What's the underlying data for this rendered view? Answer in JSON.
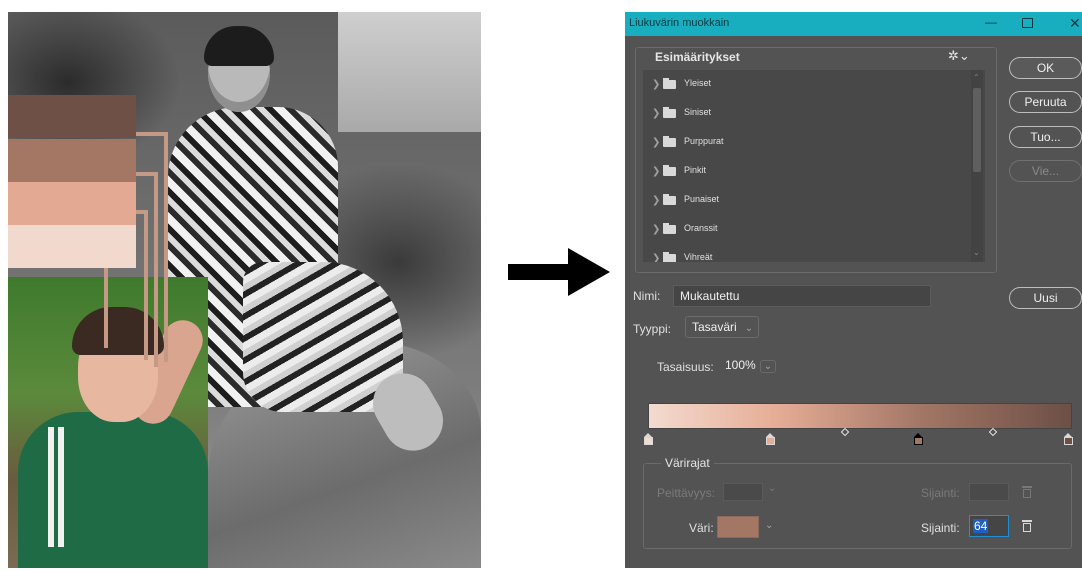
{
  "dialog": {
    "title": "Liukuvärin muokkain",
    "controls": {
      "minimize": "—",
      "maximize": "",
      "close": "✕"
    },
    "presets": {
      "label": "Esimääritykset",
      "items": [
        "Yleiset",
        "Siniset",
        "Purppurat",
        "Pinkit",
        "Punaiset",
        "Oranssit",
        "Vihreät"
      ]
    },
    "buttons": {
      "ok": "OK",
      "cancel": "Peruuta",
      "load": "Tuo...",
      "save": "Vie...",
      "new": "Uusi"
    },
    "name": {
      "label": "Nimi:",
      "value": "Mukautettu"
    },
    "type": {
      "label": "Tyyppi:",
      "value": "Tasaväri"
    },
    "smoothness": {
      "label": "Tasaisuus:",
      "value": "100%"
    },
    "gradient": {
      "stops": [
        {
          "location": 0,
          "color": "#f3dbd0"
        },
        {
          "location": 30,
          "color": "#e6ad96"
        },
        {
          "location": 64,
          "color": "#a37766",
          "selected": true
        },
        {
          "location": 100,
          "color": "#6d4f46"
        }
      ]
    },
    "color_stops": {
      "label": "Värirajat",
      "opacity_label": "Peittävyys:",
      "opacity_location_label": "Sijainti:",
      "color_label": "Väri:",
      "color_value": "#a47765",
      "location_label": "Sijainti:",
      "location_value": "64"
    }
  },
  "collage": {
    "swatches": [
      "#6e5047",
      "#a47765",
      "#e4a992",
      "#f2d9ce"
    ]
  },
  "colors": {
    "titlebar": "#19aebf",
    "dialog_bg": "#535353",
    "selection": "#1f5fbf"
  }
}
